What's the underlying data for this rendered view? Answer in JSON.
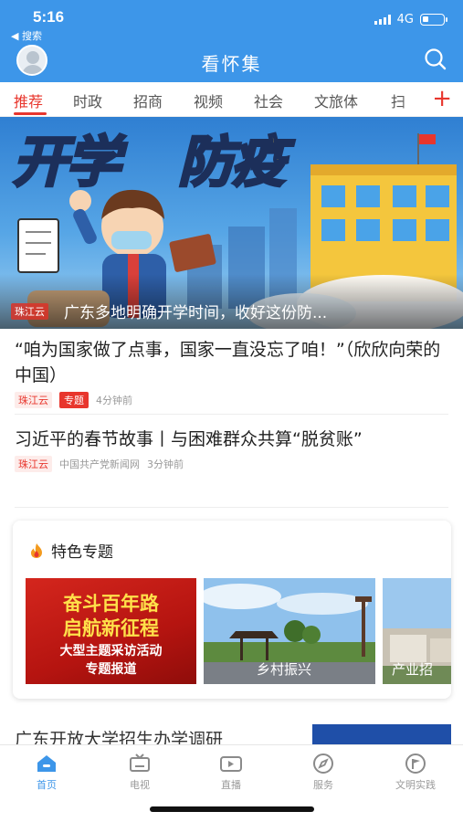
{
  "status_bar": {
    "time": "5:16",
    "back_label": "◀ 搜索",
    "network": "4G"
  },
  "header": {
    "title": "看怀集"
  },
  "tabs": [
    {
      "label": "推荐",
      "active": true
    },
    {
      "label": "时政"
    },
    {
      "label": "招商"
    },
    {
      "label": "视频"
    },
    {
      "label": "社会"
    },
    {
      "label": "文旅体"
    },
    {
      "label": "扫"
    }
  ],
  "tab_add_label": "+",
  "banner": {
    "headline_art": "开学防疫",
    "source": "珠江云",
    "title": "广东多地明确开学时间，收好这份防..."
  },
  "news": [
    {
      "title": "“咱为国家做了点事，国家一直没忘了咱！”（欣欣向荣的中国）",
      "source": "珠江云",
      "topic_tag": "专题",
      "time": "4分钟前"
    },
    {
      "title": "习近平的春节故事丨与困难群众共算“脱贫账”",
      "source": "珠江云",
      "publisher": "中国共产党新闻网",
      "time": "3分钟前"
    }
  ],
  "special": {
    "title": "特色专题",
    "topics": [
      {
        "line1": "奋斗百年路",
        "line2": "启航新征程",
        "line3": "大型主题采访活动",
        "line4": "专题报道"
      },
      {
        "label": "乡村振兴"
      },
      {
        "label": "产业招"
      }
    ]
  },
  "partial_news": {
    "title": "广东开放大学招生办学调研"
  },
  "bottom_nav": [
    {
      "label": "首页",
      "icon": "home-icon",
      "active": true
    },
    {
      "label": "电视",
      "icon": "tv-icon"
    },
    {
      "label": "直播",
      "icon": "live-icon"
    },
    {
      "label": "服务",
      "icon": "compass-icon"
    },
    {
      "label": "文明实践",
      "icon": "flag-icon"
    }
  ],
  "colors": {
    "brand_blue": "#3d96e9",
    "accent_red": "#e8362d"
  }
}
